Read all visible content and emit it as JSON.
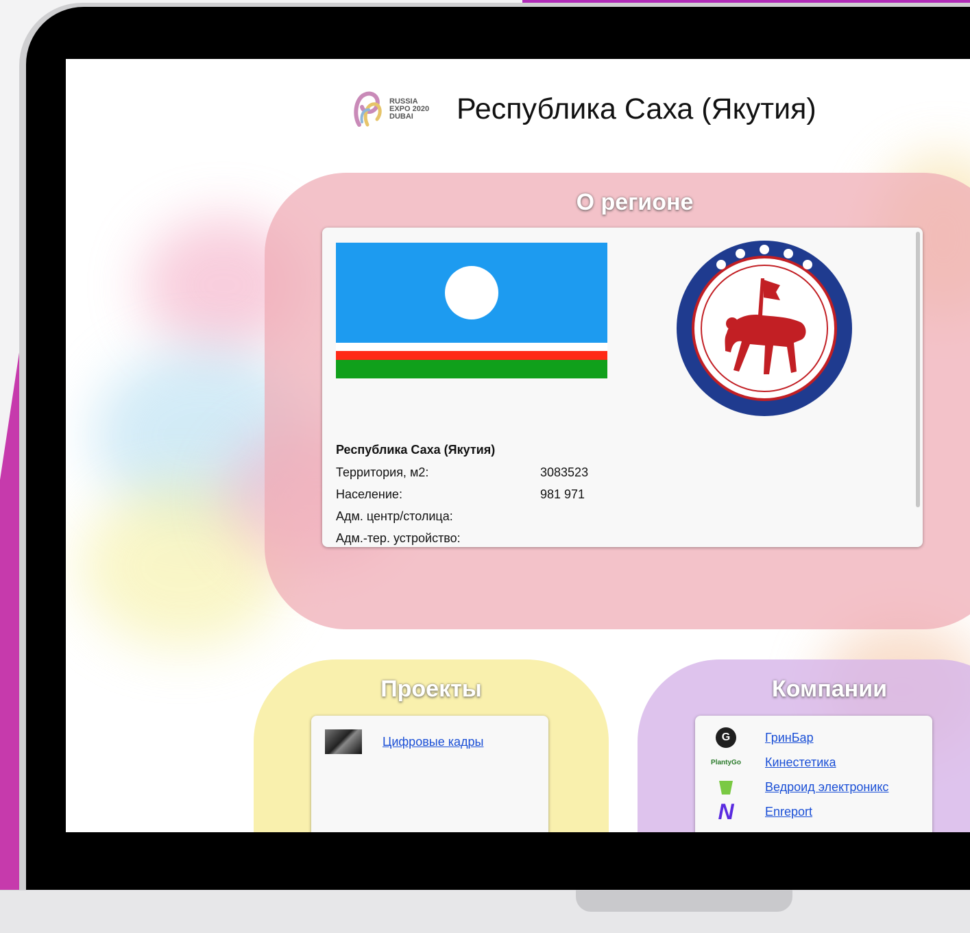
{
  "header": {
    "logo_lines": [
      "RUSSIA",
      "EXPO 2020",
      "DUBAI"
    ],
    "title": "Республика Саха (Якутия)"
  },
  "region": {
    "section_title": "О регионе",
    "name": "Республика Саха (Якутия)",
    "rows": [
      {
        "label": "Территория, м2:",
        "value": "3083523"
      },
      {
        "label": "Население:",
        "value": "981 971"
      },
      {
        "label": "Адм. центр/столица:",
        "value": ""
      },
      {
        "label": "Адм.-тер. устройство:",
        "value": ""
      }
    ]
  },
  "projects": {
    "section_title": "Проекты",
    "items": [
      {
        "label": "Цифровые кадры"
      }
    ]
  },
  "companies": {
    "section_title": "Компании",
    "items": [
      {
        "label": "ГринБар"
      },
      {
        "label": "Кинестетика"
      },
      {
        "label": "Ведроид электроникс"
      },
      {
        "label": "Enreport"
      }
    ],
    "logos": [
      "G",
      "PlantyGo",
      "N"
    ]
  },
  "colors": {
    "accent": "#c63aac",
    "region_panel": "#eeaab4",
    "projects_panel": "#f7ec96",
    "companies_panel": "#d6b4e8",
    "link": "#1a4fd6"
  }
}
